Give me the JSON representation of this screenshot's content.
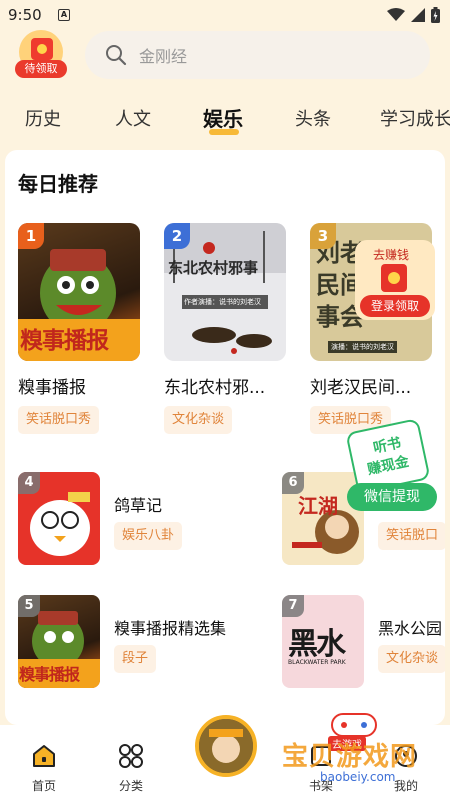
{
  "status": {
    "time": "9:50",
    "a_badge": "A"
  },
  "header": {
    "gift_label": "待领取",
    "search_placeholder": "金刚经"
  },
  "tabs": [
    {
      "label": "历史"
    },
    {
      "label": "人文"
    },
    {
      "label": "娱乐"
    },
    {
      "label": "头条"
    },
    {
      "label": "学习成长"
    }
  ],
  "section": {
    "title": "每日推荐"
  },
  "top_items": [
    {
      "rank": "1",
      "name": "糗事播报",
      "tag": "笑话脱口秀",
      "cover_text": "糗事播报",
      "rank_color": "#e8601c"
    },
    {
      "rank": "2",
      "name": "东北农村邪...",
      "tag": "文化杂谈",
      "cover_text": "东北农村邪事",
      "cover_sub": "作者演播：说书的刘老汉",
      "rank_color": "#3d6fd6"
    },
    {
      "rank": "3",
      "name": "刘老汉民间...",
      "tag": "笑话脱口秀",
      "cover_text": "刘老汉民间故事会",
      "cover_sub": "演播：说书的刘老汉",
      "rank_color": "#d9a23a"
    }
  ],
  "list_items": [
    {
      "rank": "4",
      "name": "鸽草记",
      "tag": "娱乐八卦"
    },
    {
      "rank": "6",
      "name": "",
      "tag": "笑话脱口",
      "cover_text": "江湖"
    },
    {
      "rank": "5",
      "name": "糗事播报精选集",
      "tag": "段子",
      "cover_text": "糗事播报"
    },
    {
      "rank": "7",
      "name": "黑水公园",
      "tag": "文化杂谈",
      "cover_text": "黑水",
      "cover_sub": "BLACKWATER PARK"
    }
  ],
  "promo1": {
    "top": "去赚钱",
    "bottom": "登录领取"
  },
  "promo2": {
    "line1": "听书",
    "line2": "赚现金",
    "btn": "微信提现"
  },
  "nav": [
    {
      "label": "首页"
    },
    {
      "label": "分类"
    },
    {
      "label": "书架"
    },
    {
      "label": "我的"
    }
  ],
  "watermark": {
    "brand": "宝贝游戏网",
    "url": "baobeiy.com",
    "badge": "去游戏"
  },
  "colors": {
    "accent": "#f6b226",
    "tag_text": "#e0843a",
    "promo_green": "#2fb868",
    "red": "#ea3a2c"
  }
}
